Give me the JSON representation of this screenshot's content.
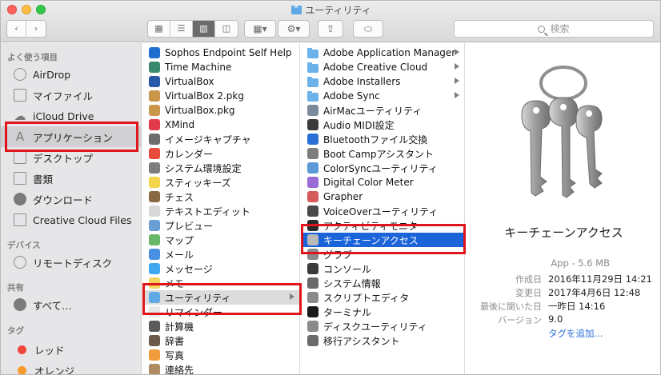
{
  "window": {
    "title": "ユーティリティ"
  },
  "toolbar": {
    "search_placeholder": "検索"
  },
  "sidebar": {
    "sections": [
      {
        "header": "よく使う項目",
        "items": [
          {
            "label": "AirDrop",
            "icon": "airdrop-icon"
          },
          {
            "label": "マイファイル",
            "icon": "all-files-icon"
          },
          {
            "label": "iCloud Drive",
            "icon": "cloud-icon"
          },
          {
            "label": "アプリケーション",
            "icon": "applications-icon",
            "selected": true
          },
          {
            "label": "デスクトップ",
            "icon": "desktop-icon"
          },
          {
            "label": "書類",
            "icon": "documents-icon"
          },
          {
            "label": "ダウンロード",
            "icon": "downloads-icon"
          },
          {
            "label": "Creative Cloud Files",
            "icon": "folder-icon"
          }
        ]
      },
      {
        "header": "デバイス",
        "items": [
          {
            "label": "リモートディスク",
            "icon": "remote-disc-icon"
          }
        ]
      },
      {
        "header": "共有",
        "items": [
          {
            "label": "すべて…",
            "icon": "network-icon"
          }
        ]
      },
      {
        "header": "タグ",
        "items": [
          {
            "label": "レッド",
            "icon": "tag-red-icon",
            "color": "#f2463e"
          },
          {
            "label": "オレンジ",
            "icon": "tag-orange-icon",
            "color": "#f89a2a"
          }
        ]
      }
    ]
  },
  "applications_column": [
    {
      "label": "Sophos Endpoint Self Help",
      "icon": "sophos-icon",
      "color": "#1e6fd0"
    },
    {
      "label": "Time Machine",
      "icon": "time-machine-icon",
      "color": "#3a8a6e"
    },
    {
      "label": "VirtualBox",
      "icon": "virtualbox-icon",
      "color": "#2859a8"
    },
    {
      "label": "VirtualBox 2.pkg",
      "icon": "package-icon",
      "color": "#c9964a"
    },
    {
      "label": "VirtualBox.pkg",
      "icon": "package-icon",
      "color": "#c9964a"
    },
    {
      "label": "XMind",
      "icon": "xmind-icon",
      "color": "#e23a4a"
    },
    {
      "label": "イメージキャプチャ",
      "icon": "image-capture-icon",
      "color": "#6d6d6d"
    },
    {
      "label": "カレンダー",
      "icon": "calendar-icon",
      "color": "#e74b3c"
    },
    {
      "label": "システム環境設定",
      "icon": "system-preferences-icon",
      "color": "#7d7d7d"
    },
    {
      "label": "スティッキーズ",
      "icon": "stickies-icon",
      "color": "#f2d54a"
    },
    {
      "label": "チェス",
      "icon": "chess-icon",
      "color": "#8a6a44"
    },
    {
      "label": "テキストエディット",
      "icon": "textedit-icon",
      "color": "#d7d7d7"
    },
    {
      "label": "プレビュー",
      "icon": "preview-icon",
      "color": "#6a9fd6"
    },
    {
      "label": "マップ",
      "icon": "maps-icon",
      "color": "#69b86a"
    },
    {
      "label": "メール",
      "icon": "mail-icon",
      "color": "#4a90e2"
    },
    {
      "label": "メッセージ",
      "icon": "messages-icon",
      "color": "#3ea8f0"
    },
    {
      "label": "メモ",
      "icon": "notes-icon",
      "color": "#f4d35e"
    },
    {
      "label": "ユーティリティ",
      "icon": "utilities-folder-icon",
      "color": "#5fa9e6",
      "selected": true,
      "has_children": true
    },
    {
      "label": "リマインダー",
      "icon": "reminders-icon",
      "color": "#e8e8e8"
    },
    {
      "label": "計算機",
      "icon": "calculator-icon",
      "color": "#5a5a5a"
    },
    {
      "label": "辞書",
      "icon": "dictionary-icon",
      "color": "#6d5a4a"
    },
    {
      "label": "写真",
      "icon": "photos-icon",
      "color": "#f29b3a"
    },
    {
      "label": "連絡先",
      "icon": "contacts-icon",
      "color": "#b08a62"
    }
  ],
  "utilities_column": [
    {
      "label": "Adobe Application Manager",
      "icon": "folder-icon",
      "color": "#6bb2ea",
      "has_children": true
    },
    {
      "label": "Adobe Creative Cloud",
      "icon": "folder-icon",
      "color": "#6bb2ea",
      "has_children": true
    },
    {
      "label": "Adobe Installers",
      "icon": "folder-icon",
      "color": "#6bb2ea",
      "has_children": true
    },
    {
      "label": "Adobe Sync",
      "icon": "folder-icon",
      "color": "#6bb2ea",
      "has_children": true
    },
    {
      "label": "AirMacユーティリティ",
      "icon": "airmac-icon",
      "color": "#7a8a9a"
    },
    {
      "label": "Audio MIDI設定",
      "icon": "midi-icon",
      "color": "#3a3a3a"
    },
    {
      "label": "Bluetoothファイル交換",
      "icon": "bluetooth-icon",
      "color": "#2a6fd6"
    },
    {
      "label": "Boot Campアシスタント",
      "icon": "bootcamp-icon",
      "color": "#7d7d7d"
    },
    {
      "label": "ColorSyncユーティリティ",
      "icon": "colorsync-icon",
      "color": "#5a9ad6"
    },
    {
      "label": "Digital Color Meter",
      "icon": "color-meter-icon",
      "color": "#9a6ad6"
    },
    {
      "label": "Grapher",
      "icon": "grapher-icon",
      "color": "#d65a5a"
    },
    {
      "label": "VoiceOverユーティリティ",
      "icon": "voiceover-icon",
      "color": "#4a4a4a"
    },
    {
      "label": "アクティビティモニタ",
      "icon": "activity-monitor-icon",
      "color": "#2a2a2a"
    },
    {
      "label": "キーチェーンアクセス",
      "icon": "keychain-icon",
      "color": "#b9b9b9",
      "selected": true
    },
    {
      "label": "グラブ",
      "icon": "grab-icon",
      "color": "#8a8a8a"
    },
    {
      "label": "コンソール",
      "icon": "console-icon",
      "color": "#3a3a3a"
    },
    {
      "label": "システム情報",
      "icon": "system-info-icon",
      "color": "#6a6a6a"
    },
    {
      "label": "スクリプトエディタ",
      "icon": "script-editor-icon",
      "color": "#8a8a8a"
    },
    {
      "label": "ターミナル",
      "icon": "terminal-icon",
      "color": "#1a1a1a"
    },
    {
      "label": "ディスクユーティリティ",
      "icon": "disk-utility-icon",
      "color": "#8a8a8a"
    },
    {
      "label": "移行アシスタント",
      "icon": "migration-icon",
      "color": "#6a6a6a"
    }
  ],
  "preview": {
    "name": "キーチェーンアクセス",
    "kind": "App - 5.6 MB",
    "created_label": "作成日",
    "created": "2016年11月29日 14:21",
    "modified_label": "変更日",
    "modified": "2017年4月6日 12:48",
    "opened_label": "最後に開いた日",
    "opened": "一昨日 14:16",
    "version_label": "バージョン",
    "version": "9.0",
    "add_tags": "タグを追加..."
  }
}
